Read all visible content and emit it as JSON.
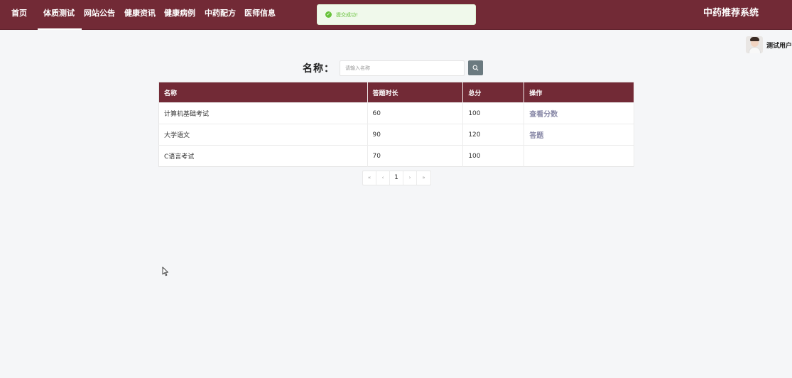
{
  "navbar": {
    "items": [
      {
        "label": "首页",
        "active": false
      },
      {
        "label": "体质测试",
        "active": true
      },
      {
        "label": "网站公告",
        "active": false
      },
      {
        "label": "健康资讯",
        "active": false
      },
      {
        "label": "健康病例",
        "active": false
      },
      {
        "label": "中药配方",
        "active": false
      },
      {
        "label": "医师信息",
        "active": false
      }
    ],
    "brand": "中药推荐系统",
    "color": "#722a36"
  },
  "toast": {
    "message": "提交成功!",
    "icon": "check-circle-icon",
    "color": "#67c23a"
  },
  "user": {
    "name": "测试用户",
    "avatar": "avatar-image"
  },
  "search": {
    "label": "名称：",
    "placeholder": "请输入名称",
    "value": "",
    "button_icon": "search-icon"
  },
  "table": {
    "headers": [
      "名称",
      "答题时长",
      "总分",
      "操作"
    ],
    "rows": [
      {
        "name": "计算机基础考试",
        "duration": "60",
        "score": "100",
        "action": "查看分数"
      },
      {
        "name": "大学语文",
        "duration": "90",
        "score": "120",
        "action": "答题"
      },
      {
        "name": "C语言考试",
        "duration": "70",
        "score": "100",
        "action": ""
      }
    ]
  },
  "pagination": {
    "first": "«",
    "prev": "‹",
    "current": "1",
    "next": "›",
    "last": "»"
  }
}
